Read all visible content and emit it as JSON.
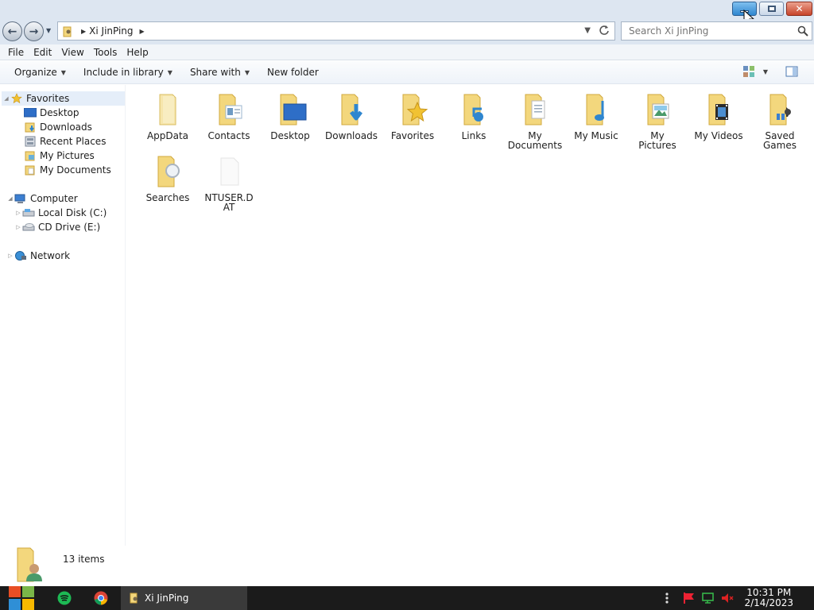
{
  "window": {
    "title_buttons": [
      "minimize",
      "restore",
      "close"
    ]
  },
  "address": {
    "crumbs": [
      "Xi JinPing"
    ]
  },
  "search": {
    "placeholder": "Search Xi JinPing"
  },
  "menu": [
    "File",
    "Edit",
    "View",
    "Tools",
    "Help"
  ],
  "toolbar": {
    "organize": "Organize",
    "include_in_library": "Include in library",
    "share_with": "Share with",
    "new_folder": "New folder"
  },
  "navpane": {
    "favorites": {
      "label": "Favorites",
      "items": [
        "Desktop",
        "Downloads",
        "Recent Places",
        "My Pictures",
        "My Documents"
      ]
    },
    "computer": {
      "label": "Computer",
      "items": [
        "Local Disk (C:)",
        "CD Drive (E:)"
      ]
    },
    "network": {
      "label": "Network"
    }
  },
  "items": [
    {
      "line1": "AppData",
      "line2": ""
    },
    {
      "line1": "Contacts",
      "line2": ""
    },
    {
      "line1": "Desktop",
      "line2": ""
    },
    {
      "line1": "Downloads",
      "line2": ""
    },
    {
      "line1": "Favorites",
      "line2": ""
    },
    {
      "line1": "Links",
      "line2": ""
    },
    {
      "line1": "My",
      "line2": "Documents"
    },
    {
      "line1": "My Music",
      "line2": ""
    },
    {
      "line1": "My",
      "line2": "Pictures"
    },
    {
      "line1": "My Videos",
      "line2": ""
    },
    {
      "line1": "Saved",
      "line2": "Games"
    },
    {
      "line1": "Searches",
      "line2": ""
    },
    {
      "line1": "NTUSER.D",
      "line2": "AT"
    }
  ],
  "details": {
    "count": "13 items"
  },
  "taskbar": {
    "task_label": "Xi JinPing",
    "time": "10:31 PM",
    "date": "2/14/2023"
  },
  "colors": {
    "folder": "#f3d77d",
    "folder_dark": "#d9b24a",
    "chrome": "#dde6f1",
    "taskbar": "#1b1b1b"
  }
}
